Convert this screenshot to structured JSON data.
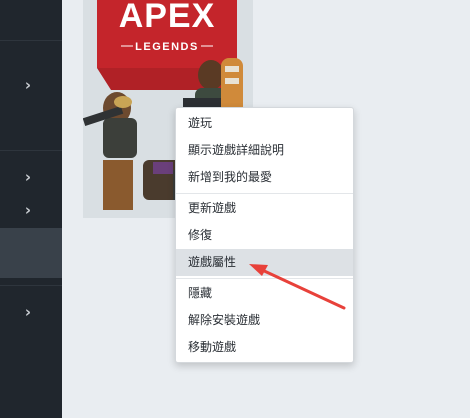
{
  "game": {
    "title": "APEX",
    "subtitle": "LEGENDS",
    "brand_color": "#c4252b"
  },
  "context_menu": {
    "items": [
      {
        "label": "遊玩"
      },
      {
        "label": "顯示遊戲詳細說明"
      },
      {
        "label": "新增到我的最愛"
      },
      {
        "label": "更新遊戲"
      },
      {
        "label": "修復"
      },
      {
        "label": "遊戲屬性",
        "highlighted": true
      },
      {
        "label": "隱藏"
      },
      {
        "label": "解除安裝遊戲"
      },
      {
        "label": "移動遊戲"
      }
    ]
  },
  "sidebar": {
    "icons": [
      "chevron-right-icon",
      "chevron-right-icon",
      "chevron-right-icon",
      "chevron-right-icon"
    ]
  },
  "annotation": {
    "color": "#e8413a",
    "icon": "red-arrow"
  }
}
